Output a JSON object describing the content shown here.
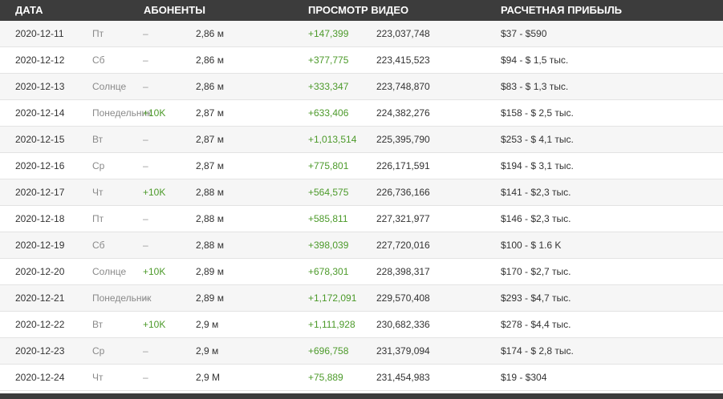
{
  "headers": {
    "date": "ДАТА",
    "subscribers": "АБОНЕНТЫ",
    "views": "ПРОСМОТР ВИДЕО",
    "earnings": "РАСЧЕТНАЯ ПРИБЫЛЬ"
  },
  "rows": [
    {
      "date": "2020-12-11",
      "day": "Пт",
      "sub_change": "–",
      "subs": "2,86 м",
      "view_change": "+147,399",
      "views": "223,037,748",
      "earnings": "$37  -  $590"
    },
    {
      "date": "2020-12-12",
      "day": "Сб",
      "sub_change": "–",
      "subs": "2,86 м",
      "view_change": "+377,775",
      "views": "223,415,523",
      "earnings": "$94 - $ 1,5 тыс."
    },
    {
      "date": "2020-12-13",
      "day": "Солнце",
      "sub_change": "–",
      "subs": "2,86 м",
      "view_change": "+333,347",
      "views": "223,748,870",
      "earnings": "$83 - $ 1,3 тыс."
    },
    {
      "date": "2020-12-14",
      "day": "Понедельник",
      "sub_change": "+10K",
      "subs": "2,87 м",
      "view_change": "+633,406",
      "views": "224,382,276",
      "earnings": "$158 - $ 2,5 тыс."
    },
    {
      "date": "2020-12-15",
      "day": "Вт",
      "sub_change": "–",
      "subs": "2,87 м",
      "view_change": "+1,013,514",
      "views": "225,395,790",
      "earnings": "$253 - $ 4,1 тыс."
    },
    {
      "date": "2020-12-16",
      "day": "Ср",
      "sub_change": "–",
      "subs": "2,87 м",
      "view_change": "+775,801",
      "views": "226,171,591",
      "earnings": "$194 - $ 3,1 тыс."
    },
    {
      "date": "2020-12-17",
      "day": "Чт",
      "sub_change": "+10K",
      "subs": "2,88 м",
      "view_change": "+564,575",
      "views": "226,736,166",
      "earnings": "$141 - $2,3 тыс."
    },
    {
      "date": "2020-12-18",
      "day": "Пт",
      "sub_change": "–",
      "subs": "2,88 м",
      "view_change": "+585,811",
      "views": "227,321,977",
      "earnings": "$146 - $2,3 тыс."
    },
    {
      "date": "2020-12-19",
      "day": "Сб",
      "sub_change": "–",
      "subs": "2,88 м",
      "view_change": "+398,039",
      "views": "227,720,016",
      "earnings": "$100 - $ 1.6 K"
    },
    {
      "date": "2020-12-20",
      "day": "Солнце",
      "sub_change": "+10K",
      "subs": "2,89 м",
      "view_change": "+678,301",
      "views": "228,398,317",
      "earnings": "$170 - $2,7 тыс."
    },
    {
      "date": "2020-12-21",
      "day": "Понедельник",
      "sub_change": "–",
      "subs": "2,89 м",
      "view_change": "+1,172,091",
      "views": "229,570,408",
      "earnings": "$293 - $4,7 тыс."
    },
    {
      "date": "2020-12-22",
      "day": "Вт",
      "sub_change": "+10K",
      "subs": "2,9 м",
      "view_change": "+1,111,928",
      "views": "230,682,336",
      "earnings": "$278 - $4,4 тыс."
    },
    {
      "date": "2020-12-23",
      "day": "Ср",
      "sub_change": "–",
      "subs": "2,9 м",
      "view_change": "+696,758",
      "views": "231,379,094",
      "earnings": "$174 - $ 2,8 тыс."
    },
    {
      "date": "2020-12-24",
      "day": "Чт",
      "sub_change": "–",
      "subs": "2,9 М",
      "view_change": "+75,889",
      "views": "231,454,983",
      "earnings": "$19  -  $304"
    }
  ]
}
